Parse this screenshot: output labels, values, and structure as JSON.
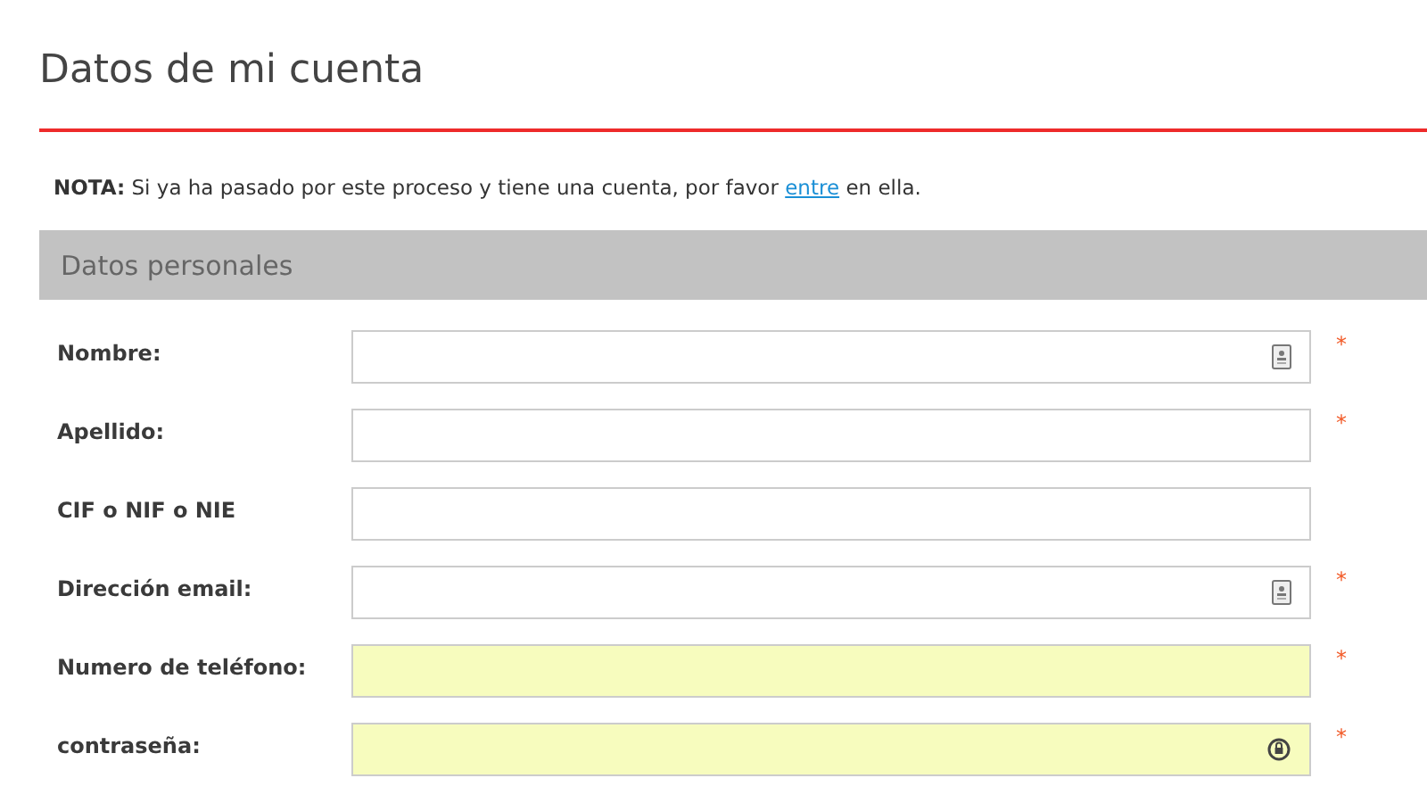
{
  "page_title": "Datos de mi cuenta",
  "note": {
    "label": "NOTA:",
    "text_before": "Si ya ha pasado por este proceso y tiene una cuenta, por favor",
    "link": "entre",
    "text_after": "en ella."
  },
  "section": {
    "title": "Datos personales"
  },
  "fields": [
    {
      "kind": "contact",
      "label": "Nombre:",
      "required": true,
      "autofilled": false
    },
    {
      "kind": "plain",
      "label": "Apellido:",
      "required": true,
      "autofilled": false
    },
    {
      "kind": "plain",
      "label": "CIF o NIF o NIE",
      "required": false,
      "autofilled": false
    },
    {
      "kind": "contact",
      "label": "Dirección email:",
      "required": true,
      "autofilled": false
    },
    {
      "kind": "plain",
      "label": "Numero de teléfono:",
      "required": true,
      "autofilled": true
    },
    {
      "kind": "password",
      "label": "contraseña:",
      "required": true,
      "autofilled": true
    }
  ],
  "required_mark": "*"
}
